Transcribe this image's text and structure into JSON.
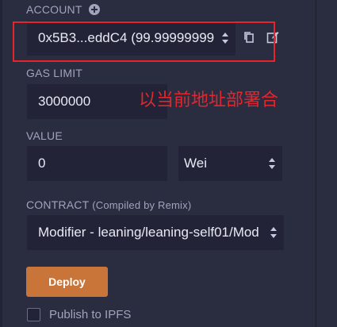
{
  "account": {
    "label": "ACCOUNT",
    "value": "0x5B3...eddC4 (99.99999999",
    "add_icon": "plus-circle-icon",
    "copy_icon": "copy-icon",
    "edit_icon": "edit-icon"
  },
  "annotation": {
    "text": "以当前地址部署合",
    "color": "#e4262c"
  },
  "gas_limit": {
    "label": "GAS LIMIT",
    "value": "3000000"
  },
  "value": {
    "label": "VALUE",
    "amount": "0",
    "unit": "Wei"
  },
  "contract": {
    "label": "CONTRACT",
    "sublabel": "(Compiled by Remix)",
    "selected": "Modifier - leaning/leaning-self01/Mod"
  },
  "deploy": {
    "label": "Deploy",
    "color": "#c97539"
  },
  "publish": {
    "label": "Publish to IPFS",
    "checked": false
  }
}
